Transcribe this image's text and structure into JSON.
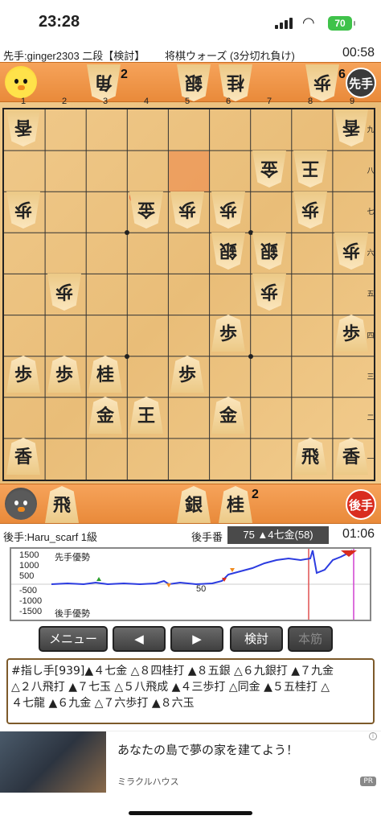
{
  "status": {
    "time": "23:28",
    "battery": "70"
  },
  "sente_row": {
    "player": "先手:ginger2303 二段【検討】",
    "game": "将棋ウォーズ (3分切れ負け)",
    "clock": "00:58"
  },
  "gote_row": {
    "player": "後手:Haru_scarf 1級",
    "turn": "後手番",
    "move": "75 ▲4七金(58)",
    "clock": "01:06"
  },
  "top_hand": {
    "role": "先手",
    "pieces": [
      {
        "label": "角",
        "count": "2"
      },
      {
        "label": "銀",
        "count": ""
      },
      {
        "label": "桂",
        "count": ""
      },
      {
        "label": "歩",
        "count": "6"
      }
    ]
  },
  "bottom_hand": {
    "role": "後手",
    "pieces": [
      {
        "label": "飛",
        "count": ""
      },
      {
        "label": "銀",
        "count": ""
      },
      {
        "label": "桂",
        "count": "2"
      }
    ]
  },
  "board": {
    "col_labels": [
      "1",
      "2",
      "3",
      "4",
      "5",
      "6",
      "7",
      "8",
      "9"
    ],
    "row_labels": [
      "九",
      "八",
      "七",
      "六",
      "五",
      "四",
      "三",
      "二",
      "一"
    ]
  },
  "graph": {
    "labels": [
      "1500",
      "1000",
      "500",
      "-500",
      "-1000",
      "-1500"
    ],
    "sente_adv": "先手優勢",
    "gote_adv": "後手優勢",
    "mark": "50"
  },
  "buttons": {
    "menu": "メニュー",
    "prev": "◀",
    "next": "▶",
    "analyze": "検討",
    "main_line": "本筋"
  },
  "kifu": {
    "line1": "#指し手[939]▲４七金 △８四桂打 ▲８五銀 △６九銀打 ▲７九金",
    "line2": "△２八飛打 ▲７七玉 △５八飛成 ▲４三歩打 △同金 ▲５五桂打 △",
    "line3": "４七龍 ▲６九金 △７六歩打 ▲８六玉"
  },
  "ad": {
    "title": "あなたの島で夢の家を建てよう！",
    "sponsor": "ミラクルハウス",
    "pr": "PR"
  },
  "colors": {
    "accent": "#e98a3a",
    "sente": "#3a3a3a",
    "gote": "#d92c1f"
  }
}
